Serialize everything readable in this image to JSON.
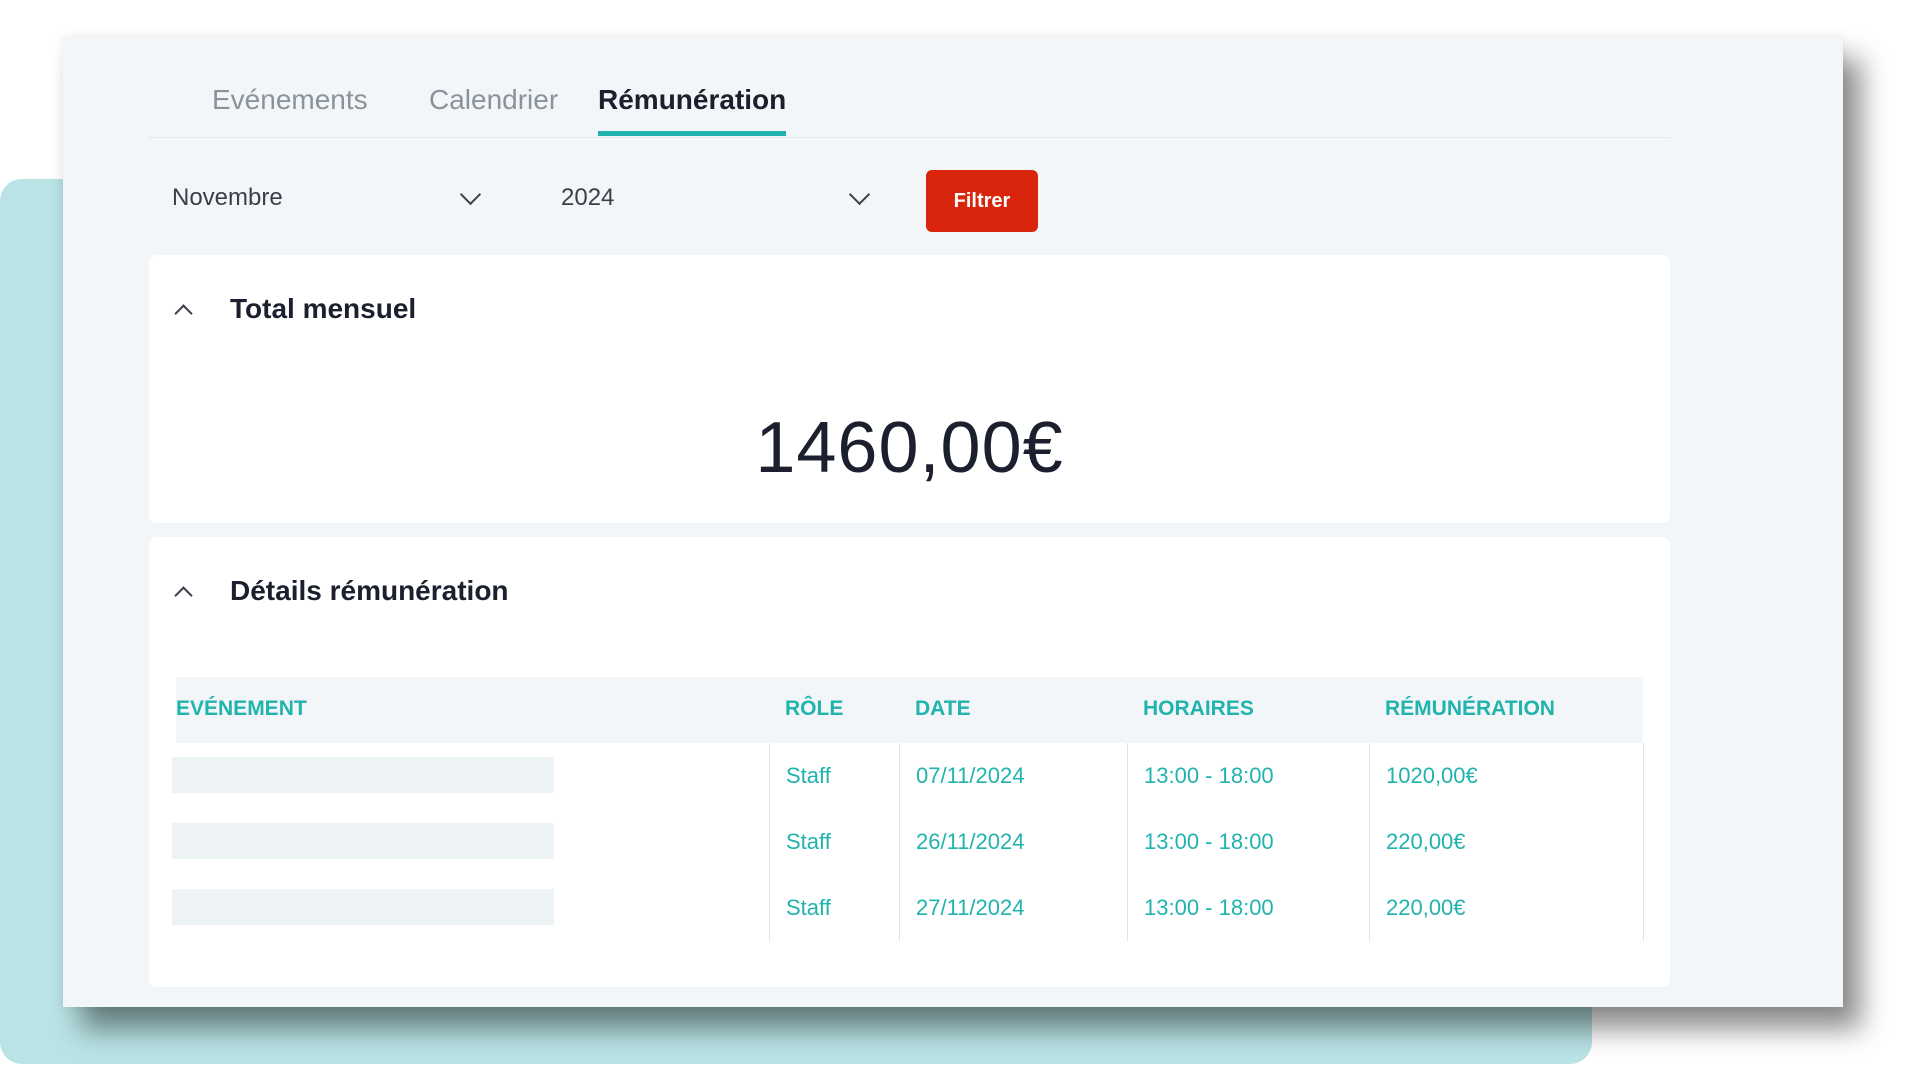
{
  "tabs": [
    {
      "label": "Evénements",
      "active": false
    },
    {
      "label": "Calendrier",
      "active": false
    },
    {
      "label": "Rémunération",
      "active": true
    }
  ],
  "filters": {
    "month": "Novembre",
    "year": "2024",
    "button_label": "Filtrer"
  },
  "total": {
    "title": "Total mensuel",
    "amount": "1460,00€"
  },
  "details": {
    "title": "Détails rémunération",
    "columns": [
      "EVÉNEMENT",
      "RÔLE",
      "DATE",
      "HORAIRES",
      "RÉMUNÉRATION"
    ],
    "rows": [
      {
        "event": "",
        "role": "Staff",
        "date": "07/11/2024",
        "hours": "13:00 - 18:00",
        "pay": "1020,00€"
      },
      {
        "event": "",
        "role": "Staff",
        "date": "26/11/2024",
        "hours": "13:00 - 18:00",
        "pay": "220,00€"
      },
      {
        "event": "",
        "role": "Staff",
        "date": "27/11/2024",
        "hours": "13:00 - 18:00",
        "pay": "220,00€"
      }
    ]
  },
  "colors": {
    "accent": "#21b3ad",
    "button": "#d8250c",
    "backdrop": "#b9e3e5",
    "text": "#1b1f2e"
  },
  "icons": [
    "chevron-down-icon",
    "chevron-up-icon"
  ]
}
